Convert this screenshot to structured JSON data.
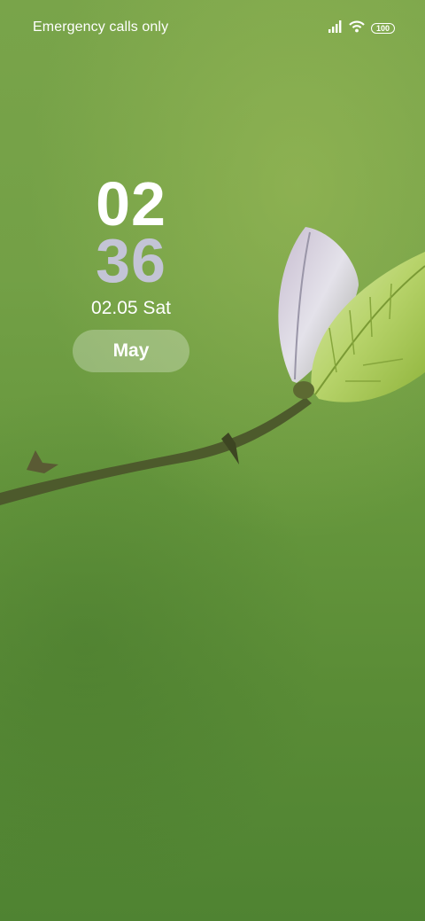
{
  "status_bar": {
    "carrier": "Emergency calls only",
    "battery_level": "100",
    "icons": [
      "signal-icon",
      "wifi-icon",
      "battery-icon"
    ]
  },
  "clock": {
    "hours": "02",
    "minutes": "36"
  },
  "date": "02.05 Sat",
  "month_pill": "May",
  "colors": {
    "text_primary": "#ffffff",
    "minutes_color": "#c3c4d6",
    "wallpaper_green": "#6e9c42"
  }
}
